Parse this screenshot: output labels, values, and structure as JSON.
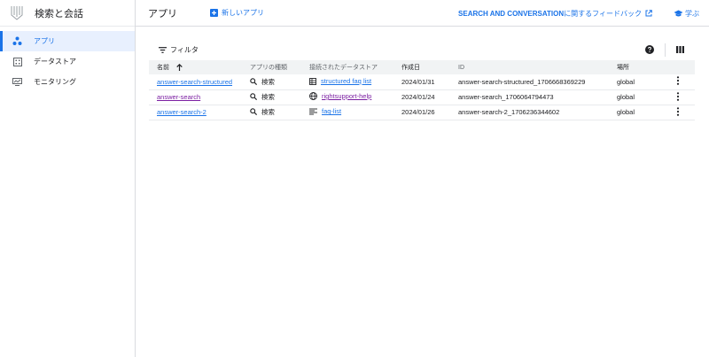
{
  "sidebar": {
    "title": "検索と会話",
    "items": [
      {
        "label": "アプリ",
        "icon": "apps-icon",
        "active": true
      },
      {
        "label": "データストア",
        "icon": "datastore-icon",
        "active": false
      },
      {
        "label": "モニタリング",
        "icon": "monitoring-icon",
        "active": false
      }
    ]
  },
  "topbar": {
    "title": "アプリ",
    "new_app_label": "新しいアプリ",
    "feedback_bold": "SEARCH AND CONVERSATION",
    "feedback_rest": " に関するフィードバック",
    "learn_label": "学ぶ"
  },
  "table": {
    "filter_label": "フィルタ",
    "columns": [
      "名前",
      "アプリの種類",
      "接続されたデータストア",
      "作成日",
      "ID",
      "場所"
    ],
    "rows": [
      {
        "name": "answer-search-structured",
        "type": "検索",
        "datastore": "structured faq list",
        "ds_icon": "table-icon",
        "date": "2024/01/31",
        "id": "answer-search-structured_1706668369229",
        "location": "global"
      },
      {
        "name": "answer-search",
        "type": "検索",
        "datastore": "rightsupport-help",
        "ds_icon": "globe-icon",
        "date": "2024/01/24",
        "id": "answer-search_1706064794473",
        "location": "global"
      },
      {
        "name": "answer-search-2",
        "type": "検索",
        "datastore": "faq-list",
        "ds_icon": "list-icon",
        "date": "2024/01/26",
        "id": "answer-search-2_1706236344602",
        "location": "global"
      }
    ]
  },
  "colors": {
    "accent": "#1a73e8",
    "visited": "#7b1fa2",
    "header_bg": "#f1f3f4"
  }
}
